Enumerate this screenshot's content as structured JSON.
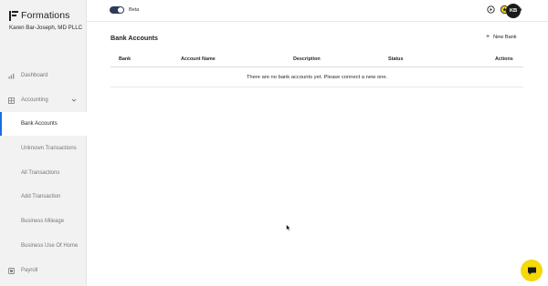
{
  "brand": {
    "name": "Formations"
  },
  "company": {
    "name": "Karen Bar-Joseph, MD PLLC"
  },
  "sidebar": {
    "items": [
      {
        "label": "Dashboard",
        "icon": "dashboard-icon"
      },
      {
        "label": "Accounting",
        "icon": "accounting-icon"
      },
      {
        "label": "Bank Accounts"
      },
      {
        "label": "Unknown Transactions"
      },
      {
        "label": "All Transactions"
      },
      {
        "label": "Add Transaction"
      },
      {
        "label": "Business Mileage"
      },
      {
        "label": "Business Use Of Home"
      },
      {
        "label": "Payroll",
        "icon": "payroll-icon"
      }
    ],
    "active_index": 2
  },
  "topbar": {
    "beta_label": "Beta",
    "avatar_initials": "KB",
    "icons": [
      "play-circle-icon",
      "star-badge-icon",
      "gear-icon"
    ]
  },
  "main": {
    "title": "Bank Accounts",
    "new_button_label": "New Bank",
    "table": {
      "columns": [
        "Bank",
        "Account Name",
        "Description",
        "Status",
        "Actions"
      ],
      "empty_message": "There are no bank accounts yet. Please connect a new one."
    }
  },
  "colors": {
    "accent": "#1a6de0",
    "sidebar_bg": "#f2f2f2",
    "chat_fab": "#f5d90a",
    "toggle_on": "#2e3a59"
  }
}
